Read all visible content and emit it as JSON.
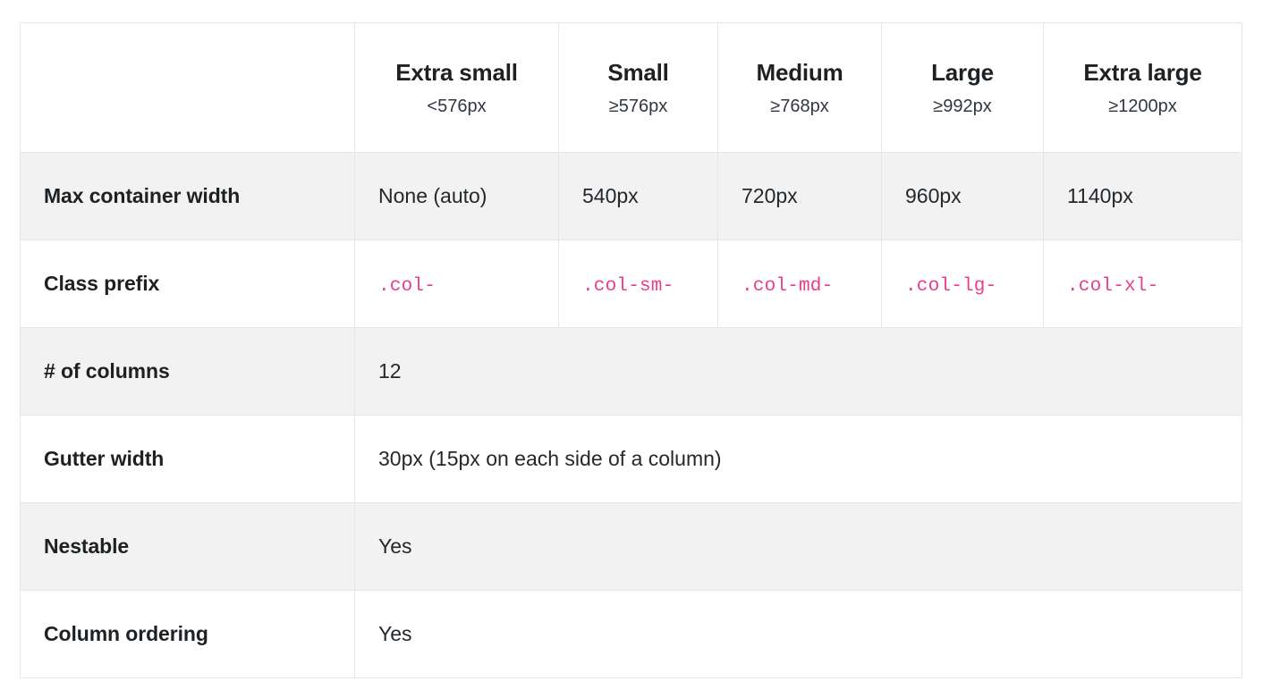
{
  "table": {
    "accent_code_color": "#e83e8c",
    "stripe_color": "#f2f2f2",
    "border_color": "#e6e6e6",
    "corner_label": "",
    "breakpoints": [
      {
        "name": "Extra small",
        "range": "<576px"
      },
      {
        "name": "Small",
        "range": "≥576px"
      },
      {
        "name": "Medium",
        "range": "≥768px"
      },
      {
        "name": "Large",
        "range": "≥992px"
      },
      {
        "name": "Extra large",
        "range": "≥1200px"
      }
    ],
    "rows": [
      {
        "label": "Max container width",
        "span": false,
        "values": [
          "None (auto)",
          "540px",
          "720px",
          "960px",
          "1140px"
        ]
      },
      {
        "label": "Class prefix",
        "span": false,
        "code": true,
        "values": [
          ".col-",
          ".col-sm-",
          ".col-md-",
          ".col-lg-",
          ".col-xl-"
        ]
      },
      {
        "label": "# of columns",
        "span": true,
        "value": "12"
      },
      {
        "label": "Gutter width",
        "span": true,
        "value": "30px (15px on each side of a column)"
      },
      {
        "label": "Nestable",
        "span": true,
        "value": "Yes"
      },
      {
        "label": "Column ordering",
        "span": true,
        "value": "Yes"
      }
    ]
  }
}
